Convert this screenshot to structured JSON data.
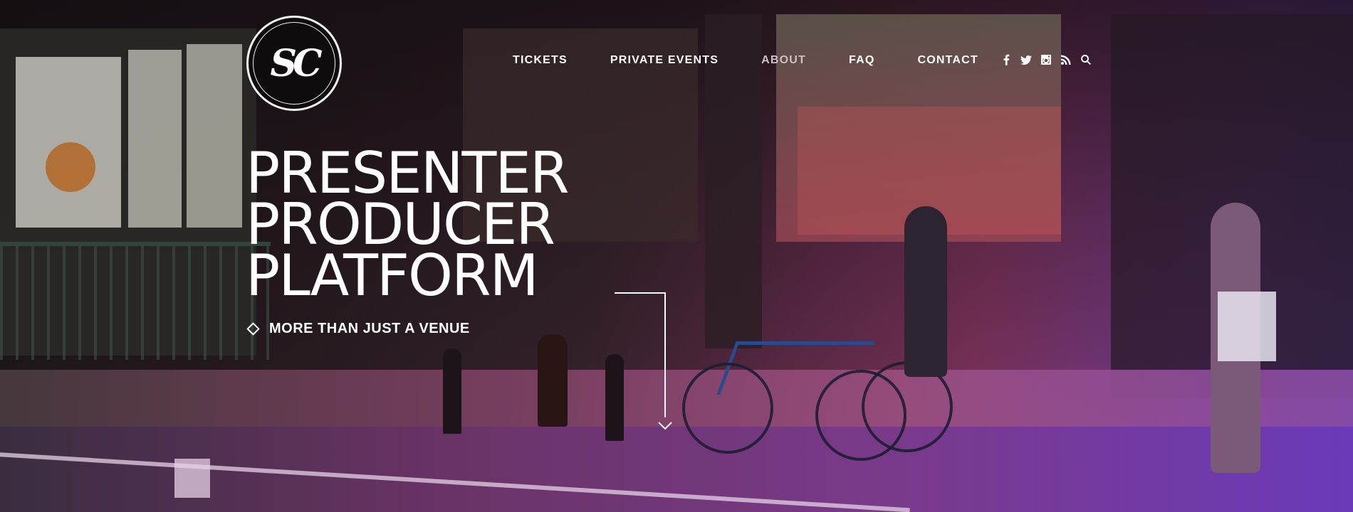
{
  "logo": {
    "text": "SC"
  },
  "nav": {
    "items": [
      {
        "label": "TICKETS",
        "active": false
      },
      {
        "label": "PRIVATE EVENTS",
        "active": false
      },
      {
        "label": "ABOUT",
        "active": true
      },
      {
        "label": "FAQ",
        "active": false
      },
      {
        "label": "CONTACT",
        "active": false
      }
    ],
    "social_icons": [
      "facebook-icon",
      "twitter-icon",
      "instagram-icon",
      "rss-icon",
      "search-icon"
    ]
  },
  "hero": {
    "headline": [
      "PRESENTER",
      "PRODUCER",
      "PLATFORM"
    ],
    "tagline": "MORE THAN JUST A VENUE"
  },
  "colors": {
    "text": "#ffffff",
    "nav_dim": "#c7c2c6",
    "overlay_purple": "#8a3765",
    "overlay_violet": "#5a3aa8"
  }
}
